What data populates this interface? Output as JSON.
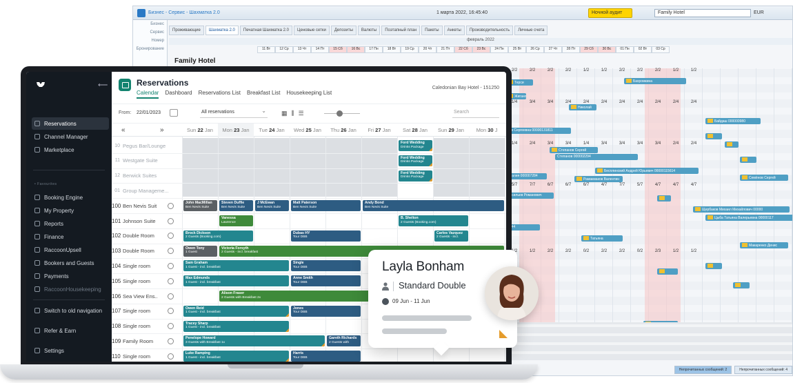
{
  "background_app": {
    "breadcrumb": "Бизнес - Сервис - Шахматка 2.0",
    "date": "1 марта 2022, 16:45:40",
    "night_audit": "Ночной аудит",
    "hotel_select": "Family Hotel",
    "currency": "EUR",
    "hotel_name": "Family Hotel",
    "side_items": [
      "Бизнес",
      "Сервис",
      "Номер",
      "Бронирование"
    ],
    "tabs": [
      "Проживающие",
      "Шахматка 2.0",
      "Печатная Шахматка 2.0",
      "Ценовые сетки",
      "Депозиты",
      "Валюты",
      "Поэтапный план",
      "Пакеты",
      "Анкеты",
      "Производительность",
      "Личные счета"
    ],
    "month": "февраль 2022",
    "days": [
      "11 Вт",
      "12 Ср",
      "13 Чт",
      "14 Пт",
      "15 Сб",
      "16 Вс",
      "17 Пн",
      "18 Вт",
      "19 Ср",
      "20 Чт",
      "21 Пт",
      "22 Сб",
      "23 Вс",
      "24 Пн",
      "25 Вт",
      "26 Ср",
      "27 Чт",
      "28 Пт",
      "29 Сб",
      "30 Вс",
      "01 Пн",
      "02 Вт",
      "03 Ср"
    ],
    "weekend_idx": [
      4,
      5,
      11,
      12,
      18,
      19
    ],
    "count_rows": [
      [
        "2/2",
        "2/2",
        "2/2",
        "2/2",
        "1/2",
        "1/2",
        "2/2",
        "2/2",
        "2/2",
        "1/2",
        "1/2"
      ],
      [
        "1/4",
        "3/4",
        "3/4",
        "2/4",
        "2/4",
        "2/4",
        "2/4",
        "2/4",
        "2/4",
        "2/4",
        "2/4"
      ],
      [
        "1/4",
        "2/4",
        "3/4",
        "3/4",
        "1/4",
        "3/4",
        "3/4",
        "3/4",
        "3/4",
        "2/4",
        "2/4"
      ],
      [
        "5/7",
        "7/7",
        "6/7",
        "6/7",
        "6/7",
        "4/7",
        "7/7",
        "5/7",
        "4/7",
        "4/7",
        "4/7"
      ],
      [
        "1/2",
        "1/2",
        "2/2",
        "2/2",
        "0/2",
        "2/2",
        "2/2",
        "0/2",
        "2/3",
        "1/2",
        "1/2"
      ]
    ],
    "bars": [
      {
        "text": "Терси",
        "y": true
      },
      {
        "text": "Бахромкина",
        "y": true
      },
      {
        "text": "Жиганов",
        "y": true
      },
      {
        "text": "Николай",
        "y": true
      },
      {
        "text": "ввв Сергеевна 00000131811",
        "y": false
      },
      {
        "text": "Байдаш 000000980",
        "y": true
      },
      {
        "text": "Степанов Сергей",
        "y": true
      },
      {
        "text": "Степанов 000002294",
        "y": false
      },
      {
        "text": "Бесплинский Андрей Юрьевич 00000115614",
        "y": true
      },
      {
        "text": "Аналия 000007284",
        "y": false
      },
      {
        "text": "Рамакмаков Валентин",
        "y": true
      },
      {
        "text": "Семёнов Сергей",
        "y": true
      },
      {
        "text": "Васильев Романович",
        "y": false
      },
      {
        "text": "Щербаков Михаил Михайлович 00000",
        "y": true
      },
      {
        "text": "Цыба Татьяна Валерьевна 00000117",
        "y": true
      },
      {
        "text": "1744",
        "y": false
      },
      {
        "text": "Татьяна",
        "y": true
      },
      {
        "text": "Макаренко Денис",
        "y": true
      }
    ],
    "status_left": "Непрочитанных сообщений: 2",
    "status_right": "Непрочитанных сообщений: 4"
  },
  "sidebar": {
    "items_top": [
      "Reservations",
      "Channel Manager",
      "Marketplace"
    ],
    "section_label": "• Favourites",
    "items_mid": [
      "Booking Engine",
      "My Property",
      "Reports",
      "Finance",
      "RaccoonUpsell",
      "Bookers and Guests",
      "Payments",
      "RaccoonHousekeeping"
    ],
    "items_bottom": [
      "Switch to old navigation",
      "Refer & Earn",
      "Settings"
    ]
  },
  "header": {
    "title": "Reservations",
    "tabs": [
      "Calendar",
      "Dashboard",
      "Reservations List",
      "Breakfast List",
      "Housekeeping List"
    ],
    "active_tab": 0,
    "hotel": "Caledonian Bay Hotel - 151250"
  },
  "toolbar": {
    "from_label": "From:",
    "from_date": "22/01/2023",
    "filter": "All reservations",
    "search_placeholder": "Search"
  },
  "calendar": {
    "prev": "«",
    "next": "»",
    "days": [
      {
        "dow": "Sun",
        "num": "22",
        "mon": "Jan",
        "today": false
      },
      {
        "dow": "Mon",
        "num": "23",
        "mon": "Jan",
        "today": true
      },
      {
        "dow": "Tue",
        "num": "24",
        "mon": "Jan",
        "today": false
      },
      {
        "dow": "Wed",
        "num": "25",
        "mon": "Jan",
        "today": false
      },
      {
        "dow": "Thu",
        "num": "26",
        "mon": "Jan",
        "today": false
      },
      {
        "dow": "Fri",
        "num": "27",
        "mon": "Jan",
        "today": false
      },
      {
        "dow": "Sat",
        "num": "28",
        "mon": "Jan",
        "today": false
      },
      {
        "dow": "Sun",
        "num": "29",
        "mon": "Jan",
        "today": false
      },
      {
        "dow": "Mon",
        "num": "30",
        "mon": "J",
        "today": false
      }
    ],
    "rooms": [
      {
        "num": "10",
        "name": "Pegus Bar/Lounge",
        "dim": true
      },
      {
        "num": "11",
        "name": "Westgate Suite",
        "dim": true
      },
      {
        "num": "12",
        "name": "Berwick Suites",
        "dim": true
      },
      {
        "num": "01",
        "name": "Group Manageme...",
        "dim": true
      },
      {
        "num": "100",
        "name": "Ben Nevis Suit",
        "dim": false
      },
      {
        "num": "101",
        "name": "Johnson Suite",
        "dim": false
      },
      {
        "num": "102",
        "name": "Double Room",
        "dim": false
      },
      {
        "num": "103",
        "name": "Double Room",
        "dim": false
      },
      {
        "num": "104",
        "name": "Single room",
        "dim": false
      },
      {
        "num": "105",
        "name": "Single room",
        "dim": false
      },
      {
        "num": "106",
        "name": "Sea View Ens..",
        "dim": false
      },
      {
        "num": "107",
        "name": "Single room",
        "dim": false
      },
      {
        "num": "108",
        "name": "Single room",
        "dim": false
      },
      {
        "num": "109",
        "name": "Family Room",
        "dim": false
      },
      {
        "num": "110",
        "name": "Single room",
        "dim": false
      }
    ],
    "bookings": [
      {
        "name": "Ford Wedding",
        "sub": "Drinks Package",
        "row": 0,
        "col": 6,
        "span": 1,
        "color": "teal"
      },
      {
        "name": "Ford Wedding",
        "sub": "Drinks Package",
        "row": 1,
        "col": 6,
        "span": 1,
        "color": "teal"
      },
      {
        "name": "Ford Wedding",
        "sub": "Drinks Package",
        "row": 2,
        "col": 6,
        "span": 1,
        "color": "teal"
      },
      {
        "name": "John MacMillan",
        "sub": "Ben Nevis Suite",
        "row": 4,
        "col": 0,
        "span": 1,
        "color": "dgray"
      },
      {
        "name": "Steven Duffie",
        "sub": "Ben Nevis Suite",
        "row": 4,
        "col": 1,
        "span": 1,
        "color": "navy"
      },
      {
        "name": "J McEwan",
        "sub": "Ben Nevis Suite",
        "row": 4,
        "col": 2,
        "span": 1,
        "color": "navy"
      },
      {
        "name": "Matt Paterson",
        "sub": "Ben Nevis Suite",
        "row": 4,
        "col": 3,
        "span": 2,
        "color": "navy"
      },
      {
        "name": "Andy Bond",
        "sub": "Ben Nevis Suite",
        "row": 4,
        "col": 5,
        "span": 4,
        "color": "navy"
      },
      {
        "name": "Vanessa",
        "sub": "Lawrence",
        "row": 5,
        "col": 1,
        "span": 1,
        "color": "green"
      },
      {
        "name": "B. Shelton",
        "sub": "2 Guests (Booking.com)",
        "row": 5,
        "col": 6,
        "span": 2,
        "color": "teal"
      },
      {
        "name": "Brock Dickson",
        "sub": "2 Guests (Booking.com)",
        "row": 6,
        "col": 0,
        "span": 2,
        "color": "teal"
      },
      {
        "name": "Dubas HY",
        "sub": "Tour DBB",
        "row": 6,
        "col": 3,
        "span": 2,
        "color": "navy"
      },
      {
        "name": "Carlos Vazquez",
        "sub": "2 Guests - incl.",
        "row": 6,
        "col": 7,
        "span": 1,
        "color": "teal"
      },
      {
        "name": "Owen Tony",
        "sub": "1 Guest",
        "row": 7,
        "col": 0,
        "span": 1,
        "color": "dgray"
      },
      {
        "name": "Victoria Forsyth",
        "sub": "2 Guests - incl. breakfast",
        "row": 7,
        "col": 1,
        "span": 8,
        "color": "green"
      },
      {
        "name": "Sam Graham",
        "sub": "1 Guest - incl. breakfast",
        "row": 8,
        "col": 0,
        "span": 3,
        "color": "teal"
      },
      {
        "name": "Single",
        "sub": "Tour DBB",
        "row": 8,
        "col": 3,
        "span": 2,
        "color": "navy"
      },
      {
        "name": "Max Edmunds",
        "sub": "1 Guest - incl. breakfast",
        "row": 9,
        "col": 0,
        "span": 3,
        "color": "teal"
      },
      {
        "name": "Anne Smith",
        "sub": "Tour DBB",
        "row": 9,
        "col": 3,
        "span": 2,
        "color": "navy"
      },
      {
        "name": "Alison Fraser",
        "sub": "2 Guests with Breakfast 2x",
        "row": 10,
        "col": 1,
        "span": 7,
        "color": "green"
      },
      {
        "name": "Owen Reid",
        "sub": "1 Guest - incl. breakfast",
        "row": 11,
        "col": 0,
        "span": 3,
        "color": "teal"
      },
      {
        "name": "Jones",
        "sub": "Tour DBB",
        "row": 11,
        "col": 3,
        "span": 2,
        "color": "navy"
      },
      {
        "name": "Tracey Sharp",
        "sub": "1 Guest - incl. breakfast",
        "row": 12,
        "col": 0,
        "span": 3,
        "color": "teal"
      },
      {
        "name": "Penelope Howard",
        "sub": "3 Guests with Breakfast 1x",
        "row": 13,
        "col": 0,
        "span": 4,
        "color": "teal"
      },
      {
        "name": "Gareth Richards",
        "sub": "2 Guests with",
        "row": 13,
        "col": 4,
        "span": 1,
        "color": "navy"
      },
      {
        "name": "Luke Ramping",
        "sub": "1 Guest - incl. breakfast",
        "row": 14,
        "col": 0,
        "span": 3,
        "color": "teal"
      },
      {
        "name": "Harris",
        "sub": "Tour DBB",
        "row": 14,
        "col": 3,
        "span": 2,
        "color": "navy"
      }
    ]
  },
  "popup": {
    "guest_name": "Layla Bonham",
    "room_type": "Standard Double",
    "dates": "09 Jun - 11 Jun"
  },
  "colors": {
    "accent": "#13836f",
    "sidebar_bg": "#141a21",
    "navy": "#2d5c82",
    "teal": "#23868f",
    "green": "#3e8a3a"
  }
}
